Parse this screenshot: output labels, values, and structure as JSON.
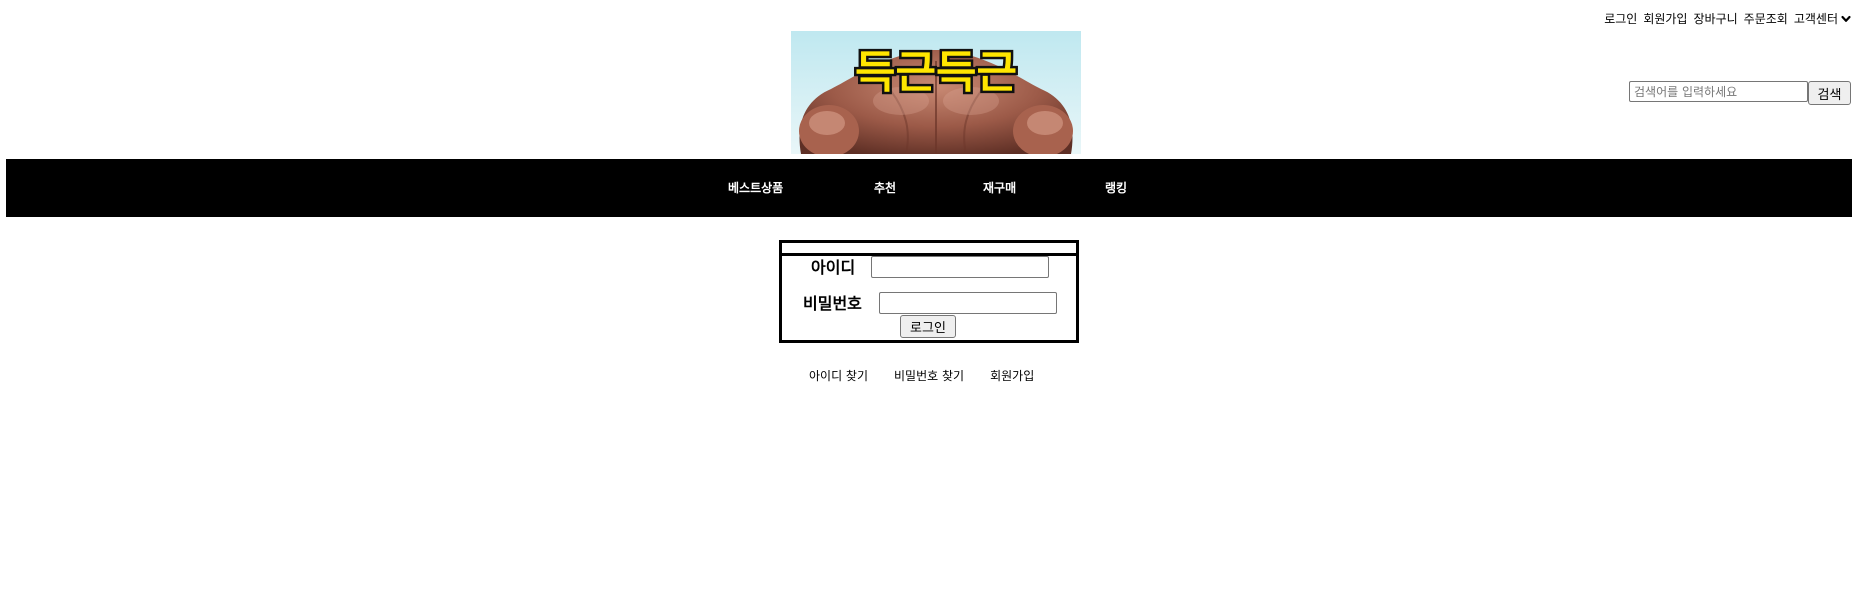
{
  "top_links": {
    "login": "로그인",
    "signup": "회원가입",
    "cart": "장바구니",
    "order_lookup": "주문조회",
    "customer_center": "고객센터"
  },
  "logo": {
    "text": "득근득근"
  },
  "search": {
    "placeholder": "검색어를 입력하세요",
    "button": "검색"
  },
  "nav": {
    "items": [
      "베스트상품",
      "추천",
      "재구매",
      "랭킹"
    ]
  },
  "login_form": {
    "id_label": "아이디",
    "password_label": "비밀번호",
    "submit": "로그인"
  },
  "bottom_links": {
    "find_id": "아이디 찾기",
    "find_password": "비밀번호 찾기",
    "signup": "회원가입"
  },
  "colors": {
    "nav_background": "#000000",
    "logo_text_fill": "#ffe600"
  }
}
